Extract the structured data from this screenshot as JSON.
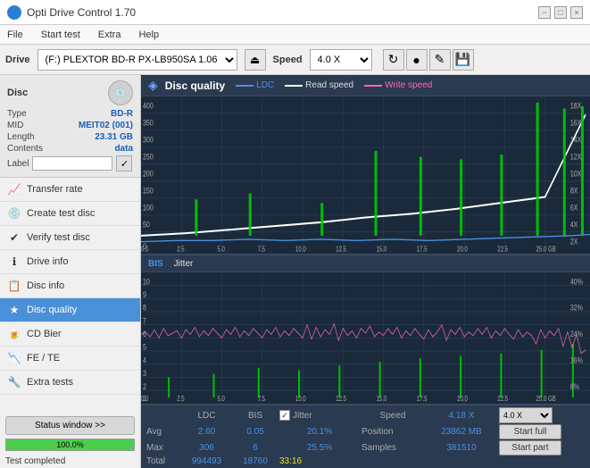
{
  "app": {
    "title": "Opti Drive Control 1.70",
    "icon": "●"
  },
  "titlebar": {
    "title": "Opti Drive Control 1.70",
    "minimize": "−",
    "maximize": "□",
    "close": "×"
  },
  "menubar": {
    "items": [
      "File",
      "Start test",
      "Extra",
      "Help"
    ]
  },
  "drivebar": {
    "drive_label": "Drive",
    "drive_value": "(F:)  PLEXTOR BD-R  PX-LB950SA 1.06",
    "eject_icon": "⏏",
    "speed_label": "Speed",
    "speed_value": "4.0 X",
    "icons": [
      "↻",
      "●",
      "✎",
      "💾"
    ]
  },
  "disc": {
    "label": "Disc",
    "type_key": "Type",
    "type_val": "BD-R",
    "mid_key": "MID",
    "mid_val": "MEIT02 (001)",
    "length_key": "Length",
    "length_val": "23.31 GB",
    "contents_key": "Contents",
    "contents_val": "data",
    "label_key": "Label",
    "label_placeholder": ""
  },
  "nav": {
    "items": [
      {
        "id": "transfer-rate",
        "label": "Transfer rate",
        "icon": "📈"
      },
      {
        "id": "create-test-disc",
        "label": "Create test disc",
        "icon": "💿"
      },
      {
        "id": "verify-test-disc",
        "label": "Verify test disc",
        "icon": "✔"
      },
      {
        "id": "drive-info",
        "label": "Drive info",
        "icon": "ℹ"
      },
      {
        "id": "disc-info",
        "label": "Disc info",
        "icon": "📋"
      },
      {
        "id": "disc-quality",
        "label": "Disc quality",
        "icon": "★",
        "active": true
      },
      {
        "id": "cd-bier",
        "label": "CD Bier",
        "icon": "🍺"
      },
      {
        "id": "fe-te",
        "label": "FE / TE",
        "icon": "📉"
      },
      {
        "id": "extra-tests",
        "label": "Extra tests",
        "icon": "🔧"
      }
    ]
  },
  "sidebar_bottom": {
    "status_btn": "Status window >>",
    "progress": "100.0%",
    "status": "Test completed"
  },
  "chart": {
    "title": "Disc quality",
    "legend": {
      "ldc_label": "LDC",
      "ldc_color": "#4a90e2",
      "read_label": "Read speed",
      "read_color": "#ffffff",
      "write_label": "Write speed",
      "write_color": "#ff69b4"
    },
    "top_y_left": [
      "400",
      "350",
      "300",
      "250",
      "200",
      "150",
      "100",
      "50",
      "0"
    ],
    "top_y_right": [
      "18X",
      "16X",
      "14X",
      "12X",
      "10X",
      "8X",
      "6X",
      "4X",
      "2X"
    ],
    "top_x": [
      "0.0",
      "2.5",
      "5.0",
      "7.5",
      "10.0",
      "12.5",
      "15.0",
      "17.5",
      "20.0",
      "22.5",
      "25.0 GB"
    ],
    "bottom_title": "BIS",
    "jitter_label": "Jitter",
    "bottom_y_left": [
      "10",
      "9",
      "8",
      "7",
      "6",
      "5",
      "4",
      "3",
      "2",
      "1"
    ],
    "bottom_y_right": [
      "40%",
      "32%",
      "24%",
      "16%",
      "8%"
    ],
    "bottom_x": [
      "0.0",
      "2.5",
      "5.0",
      "7.5",
      "10.0",
      "12.5",
      "15.0",
      "17.5",
      "20.0",
      "22.5",
      "25.0 GB"
    ]
  },
  "stats": {
    "col_headers": [
      "",
      "LDC",
      "BIS",
      "",
      "Jitter",
      "Speed",
      ""
    ],
    "avg_label": "Avg",
    "avg_ldc": "2.60",
    "avg_bis": "0.05",
    "avg_jitter": "20.1%",
    "avg_speed": "4.18 X",
    "max_label": "Max",
    "max_ldc": "306",
    "max_bis": "6",
    "max_jitter": "25.5%",
    "position_label": "Position",
    "position_val": "23862 MB",
    "total_label": "Total",
    "total_ldc": "994493",
    "total_bis": "18760",
    "samples_label": "Samples",
    "samples_val": "381510",
    "speed_dropdown": "4.0 X",
    "start_full": "Start full",
    "start_part": "Start part",
    "time": "33:16"
  }
}
